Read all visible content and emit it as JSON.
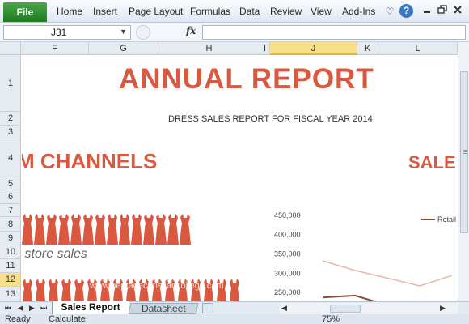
{
  "ribbon": {
    "file_label": "File",
    "tabs": [
      "Home",
      "Insert",
      "Page Layout",
      "Formulas",
      "Data",
      "Review",
      "View",
      "Add-Ins"
    ],
    "icons": [
      "heart-icon",
      "help-icon",
      "minimize-icon",
      "restore-icon",
      "close-icon"
    ]
  },
  "formula_bar": {
    "cell_ref": "J31",
    "fx_label": "fx",
    "formula": ""
  },
  "columns": [
    "F",
    "G",
    "H",
    "I",
    "J",
    "K",
    "L"
  ],
  "selected_column": "J",
  "rows": [
    "1",
    "2",
    "3",
    "4",
    "5",
    "6",
    "7",
    "8",
    "9",
    "10",
    "11",
    "12",
    "13"
  ],
  "selected_row": "12",
  "sheet": {
    "title": "ANNUAL REPORT",
    "subtitle": "DRESS SALES REPORT FOR FISCAL YEAR 2014",
    "channels_heading": "M CHANNELS",
    "sales_heading": "SALE",
    "retail_caption": "il store sales",
    "watermark": "www.heritagechristiancollege.com"
  },
  "colors": {
    "accent": "#d9583f",
    "dress": "#d9583f",
    "selection": "#f8e08a",
    "file_tab": "#2e8b2e"
  },
  "chart_data": {
    "type": "line",
    "y_ticks": [
      "450,000",
      "400,000",
      "350,000",
      "300,000",
      "250,000"
    ],
    "ylim": [
      225000,
      475000
    ],
    "series": [
      {
        "name": "Retail",
        "color": "#8b4a3a",
        "values": [
          235000,
          240000,
          215000,
          205000
        ]
      },
      {
        "name": "",
        "color": "#e6b8ae",
        "values": [
          330000,
          305000,
          285000,
          265000,
          292000
        ]
      }
    ]
  },
  "sheet_tabs": [
    "Sales Report",
    "Datasheet"
  ],
  "active_tab": "Sales Report",
  "status": {
    "ready": "Ready",
    "calculate": "Calculate",
    "zoom": "75%"
  }
}
